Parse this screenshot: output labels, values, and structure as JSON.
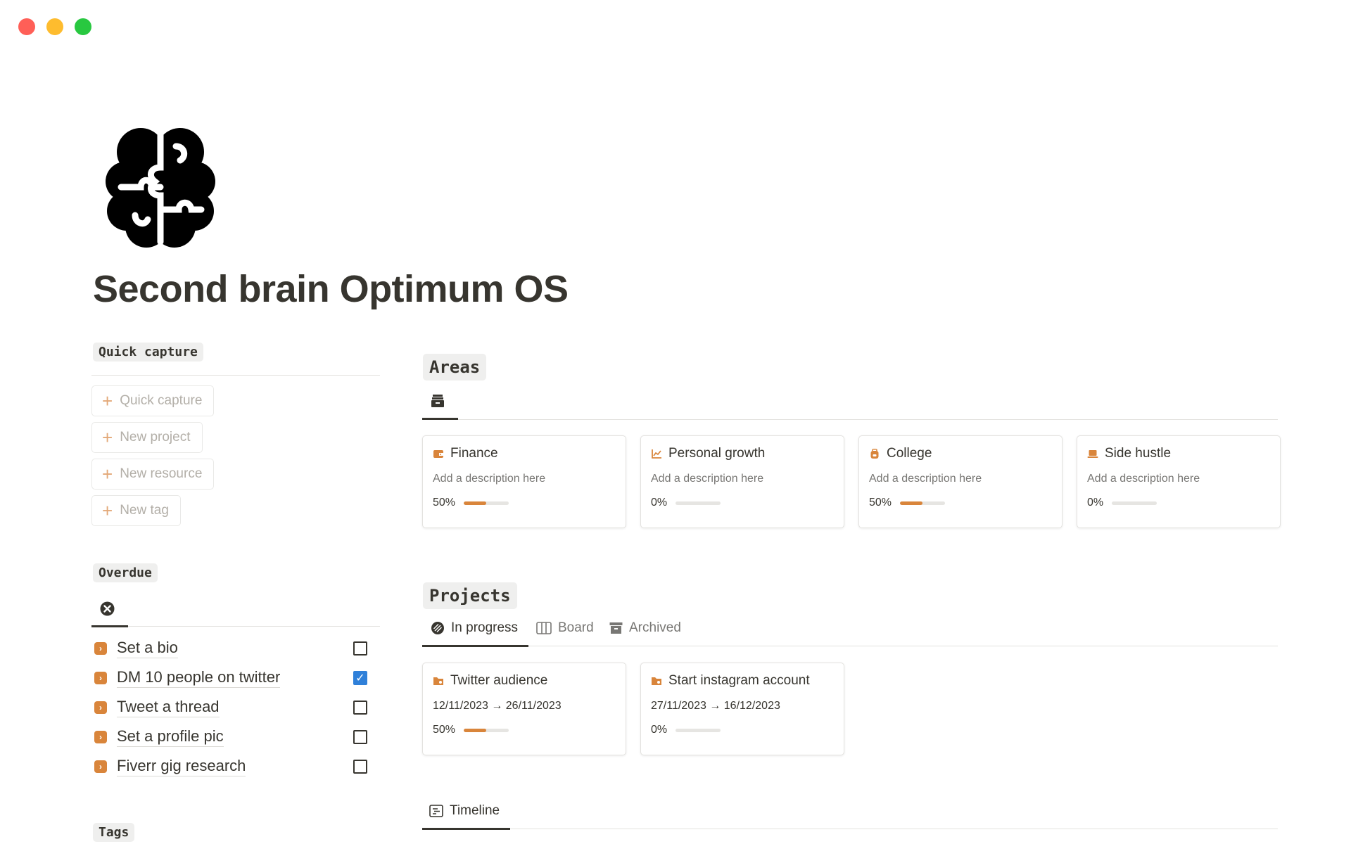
{
  "page": {
    "title": "Second brain Optimum OS",
    "icon": "brain-icon"
  },
  "quick_capture": {
    "heading": "Quick capture",
    "buttons": [
      {
        "label": "Quick capture",
        "icon": "plus-icon"
      },
      {
        "label": "New project",
        "icon": "plus-icon"
      },
      {
        "label": "New resource",
        "icon": "plus-icon"
      },
      {
        "label": "New tag",
        "icon": "plus-icon"
      }
    ]
  },
  "overdue": {
    "heading": "Overdue",
    "tab_icon": "x-circle-icon",
    "tasks": [
      {
        "label": "Set a bio",
        "checked": false
      },
      {
        "label": "DM 10 people on twitter",
        "checked": true
      },
      {
        "label": "Tweet a thread",
        "checked": false
      },
      {
        "label": "Set a profile pic",
        "checked": false
      },
      {
        "label": "Fiverr gig research",
        "checked": false
      }
    ]
  },
  "tags": {
    "heading": "Tags"
  },
  "areas": {
    "heading": "Areas",
    "tab_icon": "archive-icon",
    "cards": [
      {
        "title": "Finance",
        "icon": "wallet-icon",
        "description": "Add a description here",
        "progress_label": "50%",
        "progress": 0.5
      },
      {
        "title": "Personal growth",
        "icon": "chart-line-icon",
        "description": "Add a description here",
        "progress_label": "0%",
        "progress": 0
      },
      {
        "title": "College",
        "icon": "backpack-icon",
        "description": "Add a description here",
        "progress_label": "50%",
        "progress": 0.5
      },
      {
        "title": "Side hustle",
        "icon": "laptop-icon",
        "description": "Add a description here",
        "progress_label": "0%",
        "progress": 0
      }
    ]
  },
  "projects": {
    "heading": "Projects",
    "tabs": [
      {
        "label": "In progress",
        "icon": "progress-icon",
        "active": true
      },
      {
        "label": "Board",
        "icon": "board-icon",
        "active": false
      },
      {
        "label": "Archived",
        "icon": "archive-icon",
        "active": false
      }
    ],
    "cards": [
      {
        "title": "Twitter audience",
        "icon": "folder-icon",
        "dates": "12/11/2023 → 26/11/2023",
        "progress_label": "50%",
        "progress": 0.5
      },
      {
        "title": "Start instagram account",
        "icon": "folder-icon",
        "dates": "27/11/2023 → 16/12/2023",
        "progress_label": "0%",
        "progress": 0
      }
    ]
  },
  "timeline": {
    "tab_label": "Timeline",
    "tab_icon": "timeline-icon"
  },
  "colors": {
    "accent": "#d9853b",
    "text": "#37352f",
    "muted": "#787774",
    "checkbox_on": "#2f80d9"
  }
}
